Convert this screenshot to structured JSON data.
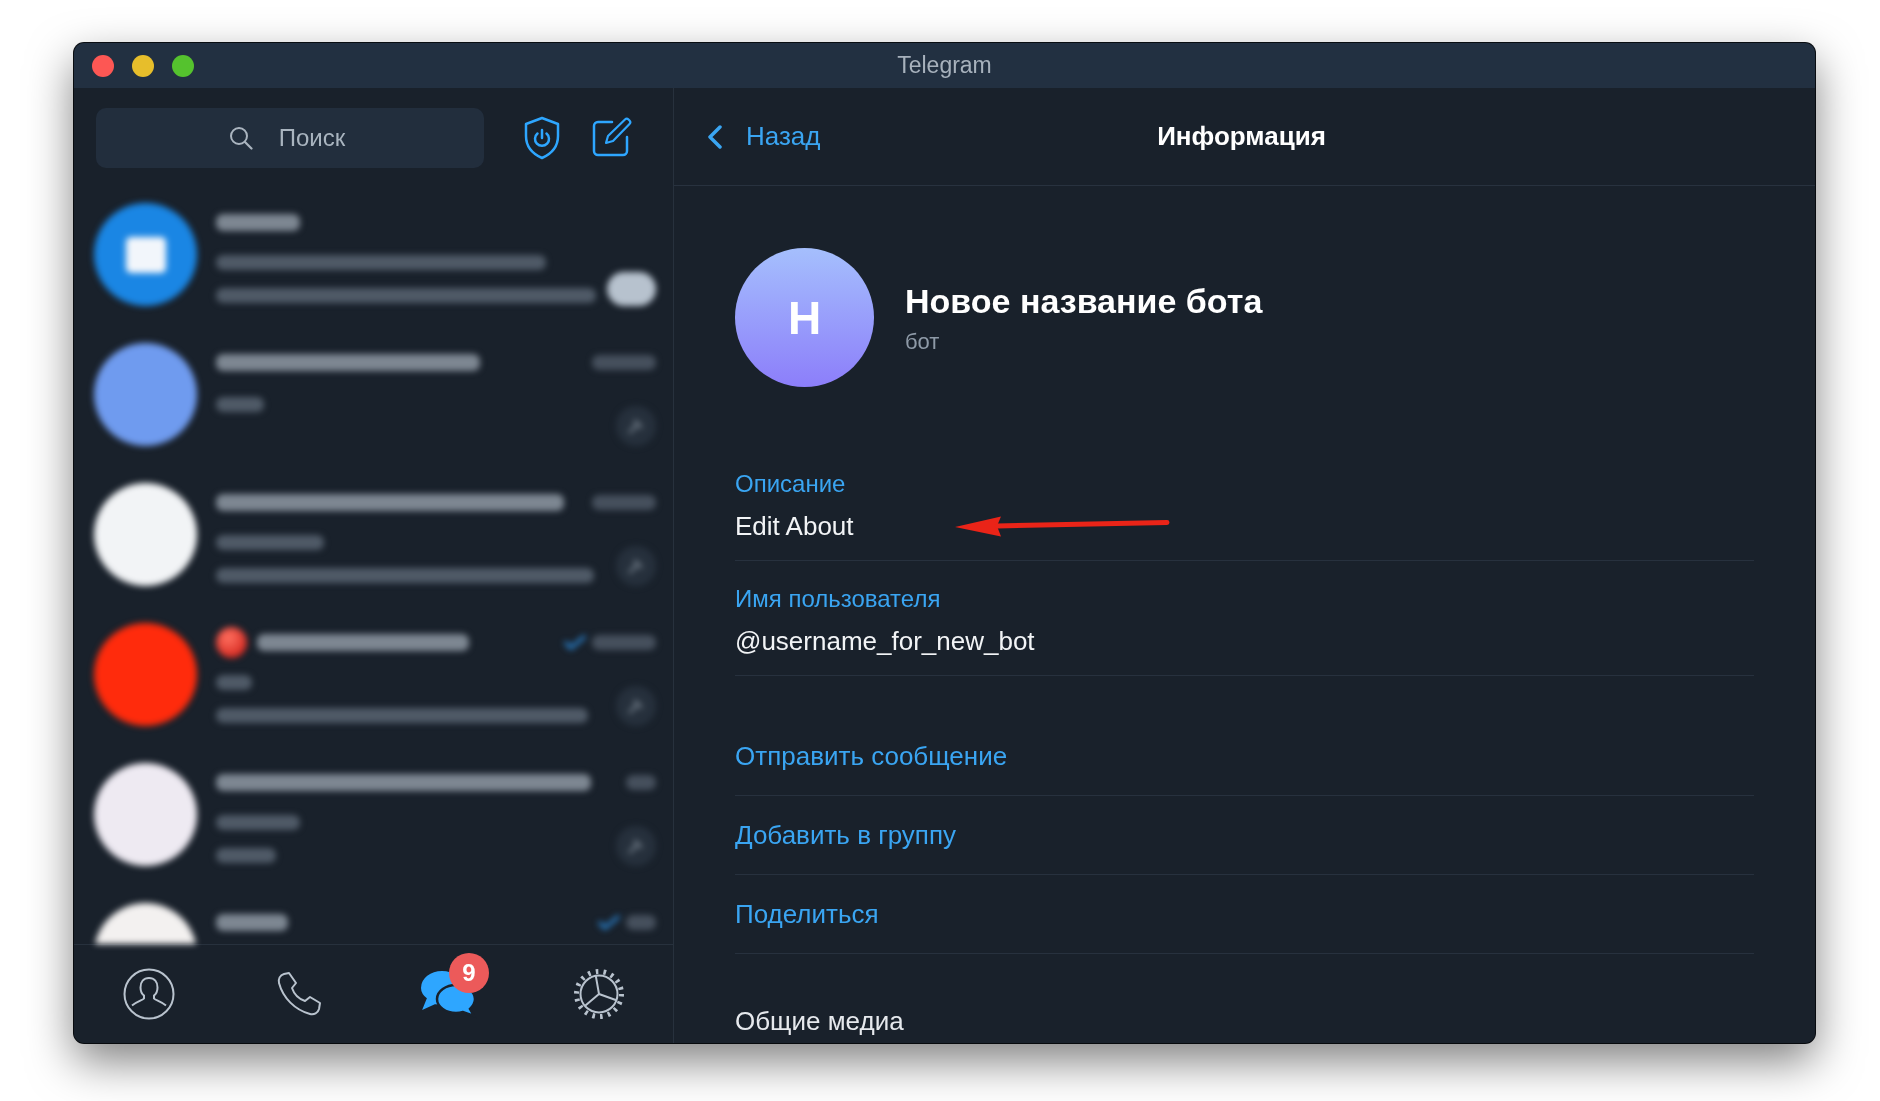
{
  "window": {
    "title": "Telegram"
  },
  "sidebar": {
    "search": {
      "placeholder": "Поиск"
    },
    "chats": [
      {
        "kind": "archive",
        "color": "#1a86e4",
        "emoji": false,
        "read": false
      },
      {
        "kind": "private",
        "color": "#6f9bef",
        "emoji": false,
        "read": false
      },
      {
        "kind": "group",
        "color": "#f2f4f6",
        "emoji": false,
        "read": false
      },
      {
        "kind": "group",
        "color": "#ff2b0c",
        "emoji": true,
        "read": true
      },
      {
        "kind": "group",
        "color": "#eeeaf2",
        "emoji": false,
        "read": false
      },
      {
        "kind": "group",
        "color": "#f3f1f0",
        "emoji": false,
        "read": true
      }
    ],
    "tabs": [
      {
        "kind": "contacts",
        "selected": false
      },
      {
        "kind": "calls",
        "selected": false
      },
      {
        "kind": "chats",
        "selected": true,
        "badge": "9"
      },
      {
        "kind": "settings",
        "selected": false
      }
    ]
  },
  "info": {
    "header": {
      "back": "Назад",
      "title": "Информация"
    },
    "profile": {
      "initial": "Н",
      "name": "Новое название бота",
      "subtitle": "бот"
    },
    "fields": [
      {
        "label": "Описание",
        "value": "Edit About",
        "arrow": true
      },
      {
        "label": "Имя пользователя",
        "value": "@username_for_new_bot",
        "arrow": false
      }
    ],
    "actions": [
      "Отправить сообщение",
      "Добавить в группу",
      "Поделиться"
    ],
    "section": "Общие медиа"
  }
}
